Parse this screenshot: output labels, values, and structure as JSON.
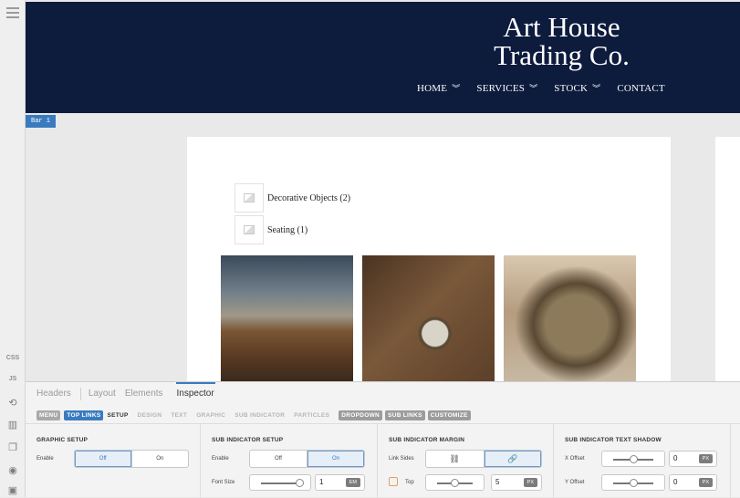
{
  "rail": {
    "css_label": "CSS",
    "js_label": "JS"
  },
  "header": {
    "logo_line1": "Art House",
    "logo_line2": "Trading Co.",
    "nav": [
      {
        "label": "HOME",
        "has_dropdown": true
      },
      {
        "label": "SERVICES",
        "has_dropdown": true
      },
      {
        "label": "STOCK",
        "has_dropdown": true
      },
      {
        "label": "CONTACT",
        "has_dropdown": false
      }
    ],
    "chevron_glyph": "⌄"
  },
  "bar_tag": "Bar 1",
  "page": {
    "categories": [
      {
        "label": "Decorative Objects (2)"
      },
      {
        "label": "Seating (1)"
      }
    ]
  },
  "panel": {
    "tabs": [
      "Headers",
      "Layout",
      "Elements",
      "Inspector"
    ],
    "subtabs": {
      "menu": "MENU",
      "top_links": "TOP LINKS",
      "setup": "SETUP",
      "design": "DESIGN",
      "text": "TEXT",
      "graphic": "GRAPHIC",
      "sub_indicator": "SUB INDICATOR",
      "particles": "PARTICLES",
      "dropdown": "DROPDOWN",
      "sub_links": "SUB LINKS",
      "customize": "CUSTOMIZE"
    },
    "graphic_setup": {
      "title": "GRAPHIC SETUP",
      "enable_label": "Enable",
      "off": "Off",
      "on": "On"
    },
    "sub_indicator_setup": {
      "title": "SUB INDICATOR SETUP",
      "enable_label": "Enable",
      "off": "Off",
      "on": "On",
      "font_size_label": "Font Size",
      "font_size_value": "1",
      "font_size_unit": "EM"
    },
    "sub_indicator_margin": {
      "title": "SUB INDICATOR MARGIN",
      "link_sides_label": "Link Sides",
      "top_label": "Top",
      "top_value": "5",
      "top_unit": "PX"
    },
    "sub_indicator_text_shadow": {
      "title": "SUB INDICATOR TEXT SHADOW",
      "x_offset_label": "X Offset",
      "x_offset_value": "0",
      "x_offset_unit": "PX",
      "y_offset_label": "Y Offset",
      "y_offset_value": "0",
      "y_offset_unit": "PX"
    }
  },
  "colors": {
    "header_bg": "#0d1b3d",
    "accent": "#3a7bbf"
  }
}
